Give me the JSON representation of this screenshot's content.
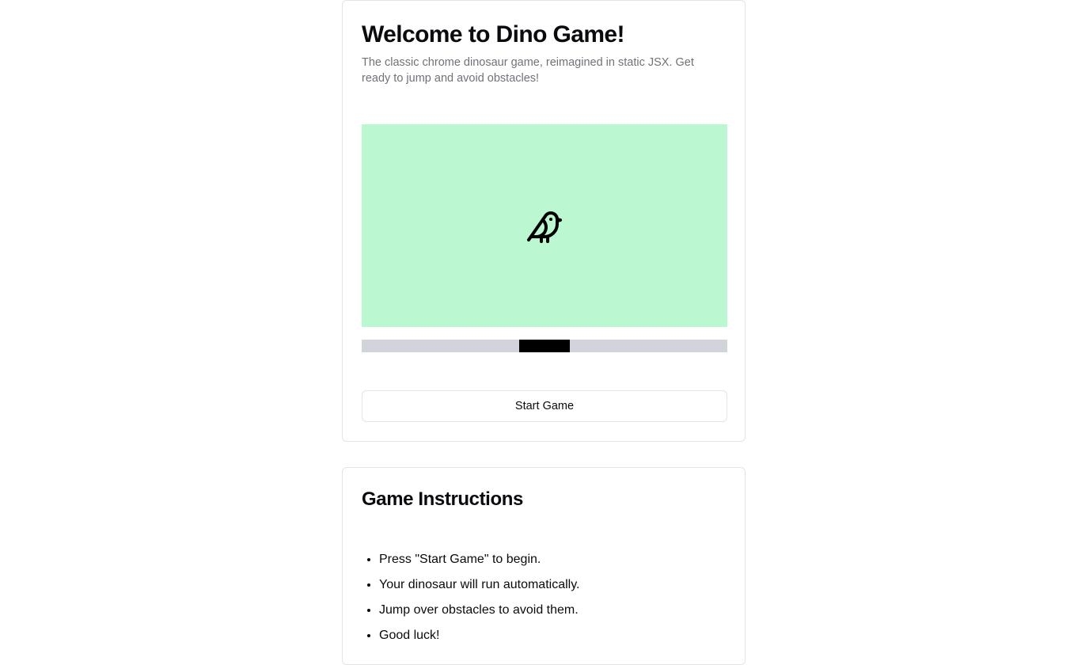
{
  "main_card": {
    "title": "Welcome to Dino Game!",
    "subtitle": "The classic chrome dinosaur game, reimagined in static JSX. Get ready to jump and avoid obstacles!",
    "game_area": {
      "background_color": "#bbf7d0",
      "character_icon": "bird-icon"
    },
    "ground": {
      "track_color": "#d1d5db",
      "obstacle_color": "#000000"
    },
    "start_button_label": "Start Game"
  },
  "instructions_card": {
    "title": "Game Instructions",
    "items": [
      "Press \"Start Game\" to begin.",
      "Your dinosaur will run automatically.",
      "Jump over obstacles to avoid them.",
      "Good luck!"
    ]
  }
}
